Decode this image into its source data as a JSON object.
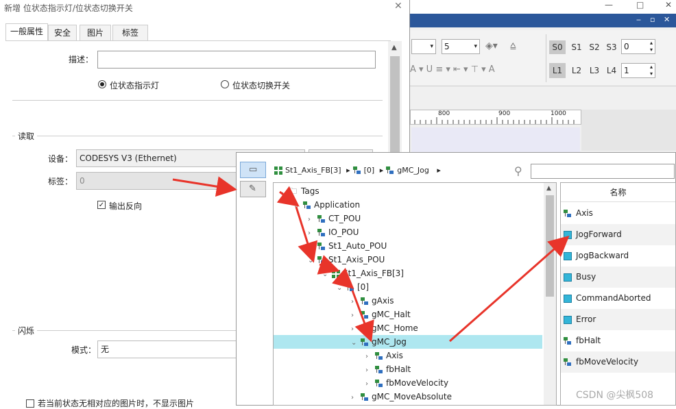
{
  "dialog": {
    "title": "新增 位状态指示灯/位状态切换开关",
    "close": "✕",
    "tabs": [
      "一般属性",
      "安全",
      "图片",
      "标签"
    ],
    "desc_label": "描述：",
    "radio_indicator": "位状态指示灯",
    "radio_switch": "位状态切换开关",
    "read_section": "读取",
    "device_label": "设备：",
    "device_value": "CODESYS V3 (Ethernet)",
    "tag_label": "标签：",
    "tag_value": "0",
    "invert_label": "输出反向",
    "blink_section": "闪烁",
    "mode_label": "模式：",
    "mode_value": "无",
    "bottom_text": "若当前状态无相对应的图片时，不显示图片"
  },
  "bg_app": {
    "font_size": "5",
    "s_buttons": [
      "S0",
      "S1",
      "S2",
      "S3"
    ],
    "s_value": "0",
    "l_buttons": [
      "L1",
      "L2",
      "L3",
      "L4"
    ],
    "l_value": "1",
    "ruler": [
      "800",
      "900",
      "1000"
    ],
    "win_buttons": [
      "—",
      "□",
      "✕"
    ],
    "inner_buttons": [
      "‒",
      "▫",
      "✕"
    ]
  },
  "tag_dialog": {
    "breadcrumb": [
      "St1_Axis_FB[3]",
      "[0]",
      "gMC_Jog"
    ],
    "tree": [
      {
        "label": "Tags",
        "level": 0,
        "icon": "folder-icon",
        "twisty": "⌄"
      },
      {
        "label": "Application",
        "level": 1,
        "icon": "tag-icon",
        "twisty": "⌄"
      },
      {
        "label": "CT_POU",
        "level": 2,
        "icon": "tag-icon",
        "twisty": "›"
      },
      {
        "label": "IO_POU",
        "level": 2,
        "icon": "tag-icon",
        "twisty": "›"
      },
      {
        "label": "St1_Auto_POU",
        "level": 2,
        "icon": "tag-icon",
        "twisty": ""
      },
      {
        "label": "St1_Axis_POU",
        "level": 2,
        "icon": "tag-icon",
        "twisty": "⌄"
      },
      {
        "label": "St1_Axis_FB[3]",
        "level": 3,
        "icon": "array-icon",
        "twisty": "⌄"
      },
      {
        "label": "[0]",
        "level": 4,
        "icon": "tag-icon",
        "twisty": "⌄"
      },
      {
        "label": "gAxis",
        "level": 5,
        "icon": "tag-icon",
        "twisty": "›"
      },
      {
        "label": "gMC_Halt",
        "level": 5,
        "icon": "tag-icon",
        "twisty": "›"
      },
      {
        "label": "gMC_Home",
        "level": 5,
        "icon": "tag-icon",
        "twisty": "›"
      },
      {
        "label": "gMC_Jog",
        "level": 5,
        "icon": "tag-icon",
        "twisty": "⌄",
        "selected": true
      },
      {
        "label": "Axis",
        "level": 6,
        "icon": "tag-icon",
        "twisty": "›"
      },
      {
        "label": "fbHalt",
        "level": 6,
        "icon": "tag-icon",
        "twisty": "›"
      },
      {
        "label": "fbMoveVelocity",
        "level": 6,
        "icon": "tag-icon",
        "twisty": "›"
      },
      {
        "label": "gMC_MoveAbsolute",
        "level": 5,
        "icon": "tag-icon",
        "twisty": "›"
      }
    ],
    "list_header": "名称",
    "list": [
      {
        "label": "Axis",
        "icon": "tag-icon"
      },
      {
        "label": "JogForward",
        "icon": "bool-icon"
      },
      {
        "label": "JogBackward",
        "icon": "bool-icon"
      },
      {
        "label": "Busy",
        "icon": "bool-icon"
      },
      {
        "label": "CommandAborted",
        "icon": "bool-icon"
      },
      {
        "label": "Error",
        "icon": "bool-icon"
      },
      {
        "label": "fbHalt",
        "icon": "tag-icon"
      },
      {
        "label": "fbMoveVelocity",
        "icon": "tag-icon"
      }
    ]
  },
  "watermark": "CSDN @尖枫508",
  "colors": {
    "accent_blue": "#2b579a",
    "selection": "#aee7f0",
    "arrow_red": "#e8342a"
  }
}
